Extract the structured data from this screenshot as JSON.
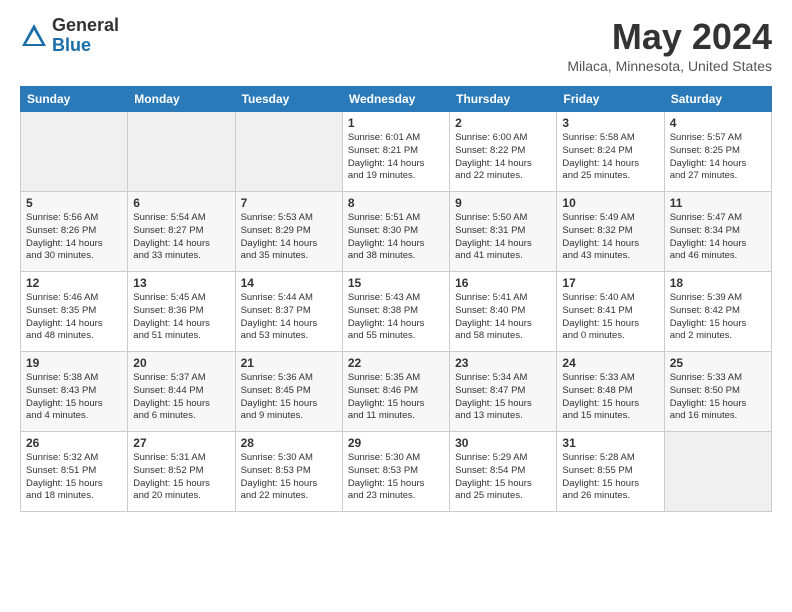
{
  "logo": {
    "general": "General",
    "blue": "Blue"
  },
  "title": "May 2024",
  "location": "Milaca, Minnesota, United States",
  "days_of_week": [
    "Sunday",
    "Monday",
    "Tuesday",
    "Wednesday",
    "Thursday",
    "Friday",
    "Saturday"
  ],
  "weeks": [
    [
      {
        "day": "",
        "info": ""
      },
      {
        "day": "",
        "info": ""
      },
      {
        "day": "",
        "info": ""
      },
      {
        "day": "1",
        "info": "Sunrise: 6:01 AM\nSunset: 8:21 PM\nDaylight: 14 hours\nand 19 minutes."
      },
      {
        "day": "2",
        "info": "Sunrise: 6:00 AM\nSunset: 8:22 PM\nDaylight: 14 hours\nand 22 minutes."
      },
      {
        "day": "3",
        "info": "Sunrise: 5:58 AM\nSunset: 8:24 PM\nDaylight: 14 hours\nand 25 minutes."
      },
      {
        "day": "4",
        "info": "Sunrise: 5:57 AM\nSunset: 8:25 PM\nDaylight: 14 hours\nand 27 minutes."
      }
    ],
    [
      {
        "day": "5",
        "info": "Sunrise: 5:56 AM\nSunset: 8:26 PM\nDaylight: 14 hours\nand 30 minutes."
      },
      {
        "day": "6",
        "info": "Sunrise: 5:54 AM\nSunset: 8:27 PM\nDaylight: 14 hours\nand 33 minutes."
      },
      {
        "day": "7",
        "info": "Sunrise: 5:53 AM\nSunset: 8:29 PM\nDaylight: 14 hours\nand 35 minutes."
      },
      {
        "day": "8",
        "info": "Sunrise: 5:51 AM\nSunset: 8:30 PM\nDaylight: 14 hours\nand 38 minutes."
      },
      {
        "day": "9",
        "info": "Sunrise: 5:50 AM\nSunset: 8:31 PM\nDaylight: 14 hours\nand 41 minutes."
      },
      {
        "day": "10",
        "info": "Sunrise: 5:49 AM\nSunset: 8:32 PM\nDaylight: 14 hours\nand 43 minutes."
      },
      {
        "day": "11",
        "info": "Sunrise: 5:47 AM\nSunset: 8:34 PM\nDaylight: 14 hours\nand 46 minutes."
      }
    ],
    [
      {
        "day": "12",
        "info": "Sunrise: 5:46 AM\nSunset: 8:35 PM\nDaylight: 14 hours\nand 48 minutes."
      },
      {
        "day": "13",
        "info": "Sunrise: 5:45 AM\nSunset: 8:36 PM\nDaylight: 14 hours\nand 51 minutes."
      },
      {
        "day": "14",
        "info": "Sunrise: 5:44 AM\nSunset: 8:37 PM\nDaylight: 14 hours\nand 53 minutes."
      },
      {
        "day": "15",
        "info": "Sunrise: 5:43 AM\nSunset: 8:38 PM\nDaylight: 14 hours\nand 55 minutes."
      },
      {
        "day": "16",
        "info": "Sunrise: 5:41 AM\nSunset: 8:40 PM\nDaylight: 14 hours\nand 58 minutes."
      },
      {
        "day": "17",
        "info": "Sunrise: 5:40 AM\nSunset: 8:41 PM\nDaylight: 15 hours\nand 0 minutes."
      },
      {
        "day": "18",
        "info": "Sunrise: 5:39 AM\nSunset: 8:42 PM\nDaylight: 15 hours\nand 2 minutes."
      }
    ],
    [
      {
        "day": "19",
        "info": "Sunrise: 5:38 AM\nSunset: 8:43 PM\nDaylight: 15 hours\nand 4 minutes."
      },
      {
        "day": "20",
        "info": "Sunrise: 5:37 AM\nSunset: 8:44 PM\nDaylight: 15 hours\nand 6 minutes."
      },
      {
        "day": "21",
        "info": "Sunrise: 5:36 AM\nSunset: 8:45 PM\nDaylight: 15 hours\nand 9 minutes."
      },
      {
        "day": "22",
        "info": "Sunrise: 5:35 AM\nSunset: 8:46 PM\nDaylight: 15 hours\nand 11 minutes."
      },
      {
        "day": "23",
        "info": "Sunrise: 5:34 AM\nSunset: 8:47 PM\nDaylight: 15 hours\nand 13 minutes."
      },
      {
        "day": "24",
        "info": "Sunrise: 5:33 AM\nSunset: 8:48 PM\nDaylight: 15 hours\nand 15 minutes."
      },
      {
        "day": "25",
        "info": "Sunrise: 5:33 AM\nSunset: 8:50 PM\nDaylight: 15 hours\nand 16 minutes."
      }
    ],
    [
      {
        "day": "26",
        "info": "Sunrise: 5:32 AM\nSunset: 8:51 PM\nDaylight: 15 hours\nand 18 minutes."
      },
      {
        "day": "27",
        "info": "Sunrise: 5:31 AM\nSunset: 8:52 PM\nDaylight: 15 hours\nand 20 minutes."
      },
      {
        "day": "28",
        "info": "Sunrise: 5:30 AM\nSunset: 8:53 PM\nDaylight: 15 hours\nand 22 minutes."
      },
      {
        "day": "29",
        "info": "Sunrise: 5:30 AM\nSunset: 8:53 PM\nDaylight: 15 hours\nand 23 minutes."
      },
      {
        "day": "30",
        "info": "Sunrise: 5:29 AM\nSunset: 8:54 PM\nDaylight: 15 hours\nand 25 minutes."
      },
      {
        "day": "31",
        "info": "Sunrise: 5:28 AM\nSunset: 8:55 PM\nDaylight: 15 hours\nand 26 minutes."
      },
      {
        "day": "",
        "info": ""
      }
    ]
  ]
}
